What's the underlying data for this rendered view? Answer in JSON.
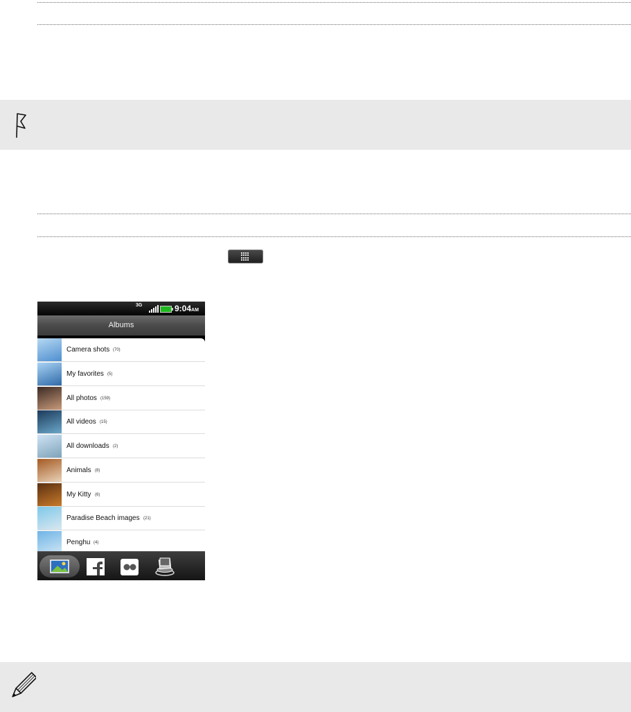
{
  "phone": {
    "status_bar": {
      "network": "3G",
      "time": "9:04",
      "ampm": "AM"
    },
    "title": "Albums",
    "albums": [
      {
        "name": "Camera shots",
        "count": "(70)",
        "thumb_colors": [
          "#b6d8f2",
          "#4e8fcf"
        ]
      },
      {
        "name": "My favorites",
        "count": "(5)",
        "thumb_colors": [
          "#a9d3f4",
          "#2f6aa9"
        ]
      },
      {
        "name": "All photos",
        "count": "(159)",
        "thumb_colors": [
          "#3b2a24",
          "#c89a7a"
        ]
      },
      {
        "name": "All videos",
        "count": "(15)",
        "thumb_colors": [
          "#1c3a5a",
          "#6aa7c9"
        ]
      },
      {
        "name": "All downloads",
        "count": "(2)",
        "thumb_colors": [
          "#cfe3f5",
          "#7fa3b9"
        ]
      },
      {
        "name": "Animals",
        "count": "(8)",
        "thumb_colors": [
          "#a45a23",
          "#e9d2b8"
        ]
      },
      {
        "name": "My Kitty",
        "count": "(6)",
        "thumb_colors": [
          "#5a3012",
          "#c87a2a"
        ]
      },
      {
        "name": "Paradise Beach images",
        "count": "(21)",
        "thumb_colors": [
          "#7ec8ea",
          "#d9e7ef"
        ]
      },
      {
        "name": "Penghu",
        "count": "(4)",
        "thumb_colors": [
          "#6fb4e6",
          "#cfe6f4"
        ]
      }
    ],
    "bottom_tabs": [
      {
        "icon": "gallery-icon"
      },
      {
        "icon": "facebook-icon"
      },
      {
        "icon": "flickr-icon"
      },
      {
        "icon": "stack-icon"
      }
    ]
  },
  "colors": {
    "callout_background": "#e9e9e9",
    "battery": "#1fb81f"
  }
}
